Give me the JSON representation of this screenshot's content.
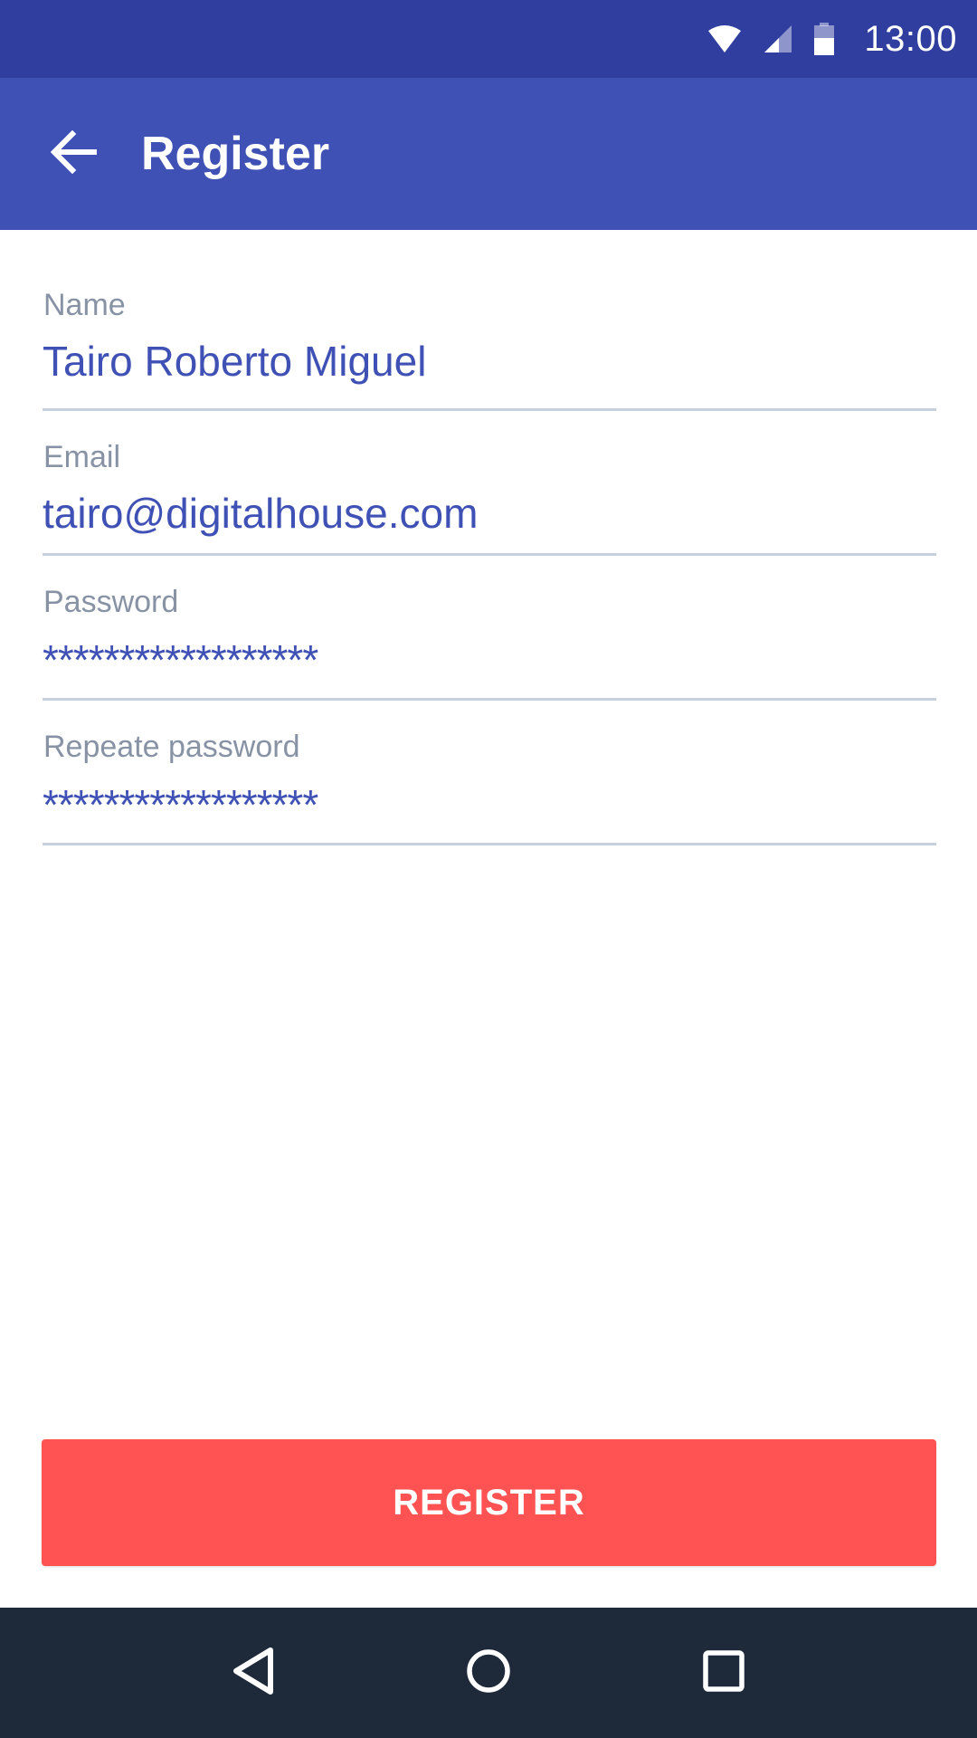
{
  "status_bar": {
    "time": "13:00",
    "icons": [
      "wifi-icon",
      "cell-signal-icon",
      "battery-icon"
    ],
    "background": "#303F9F"
  },
  "app_bar": {
    "title": "Register",
    "back_icon": "arrow-left-icon",
    "background": "#3F51B5"
  },
  "form": {
    "fields": [
      {
        "label": "Name",
        "value": "Tairo Roberto Miguel",
        "type": "text"
      },
      {
        "label": "Email",
        "value": "tairo@digitalhouse.com",
        "type": "email"
      },
      {
        "label": "Password",
        "value": "******************",
        "type": "password"
      },
      {
        "label": "Repeate password",
        "value": "******************",
        "type": "password"
      }
    ],
    "text_color": "#3F51B5",
    "label_color": "#8793A4"
  },
  "actions": {
    "register_label": "REGISTER",
    "register_color": "#FF5252"
  },
  "nav_bar": {
    "buttons": [
      "back-triangle-icon",
      "home-circle-icon",
      "recents-square-icon"
    ],
    "background": "#1E2A3A"
  }
}
